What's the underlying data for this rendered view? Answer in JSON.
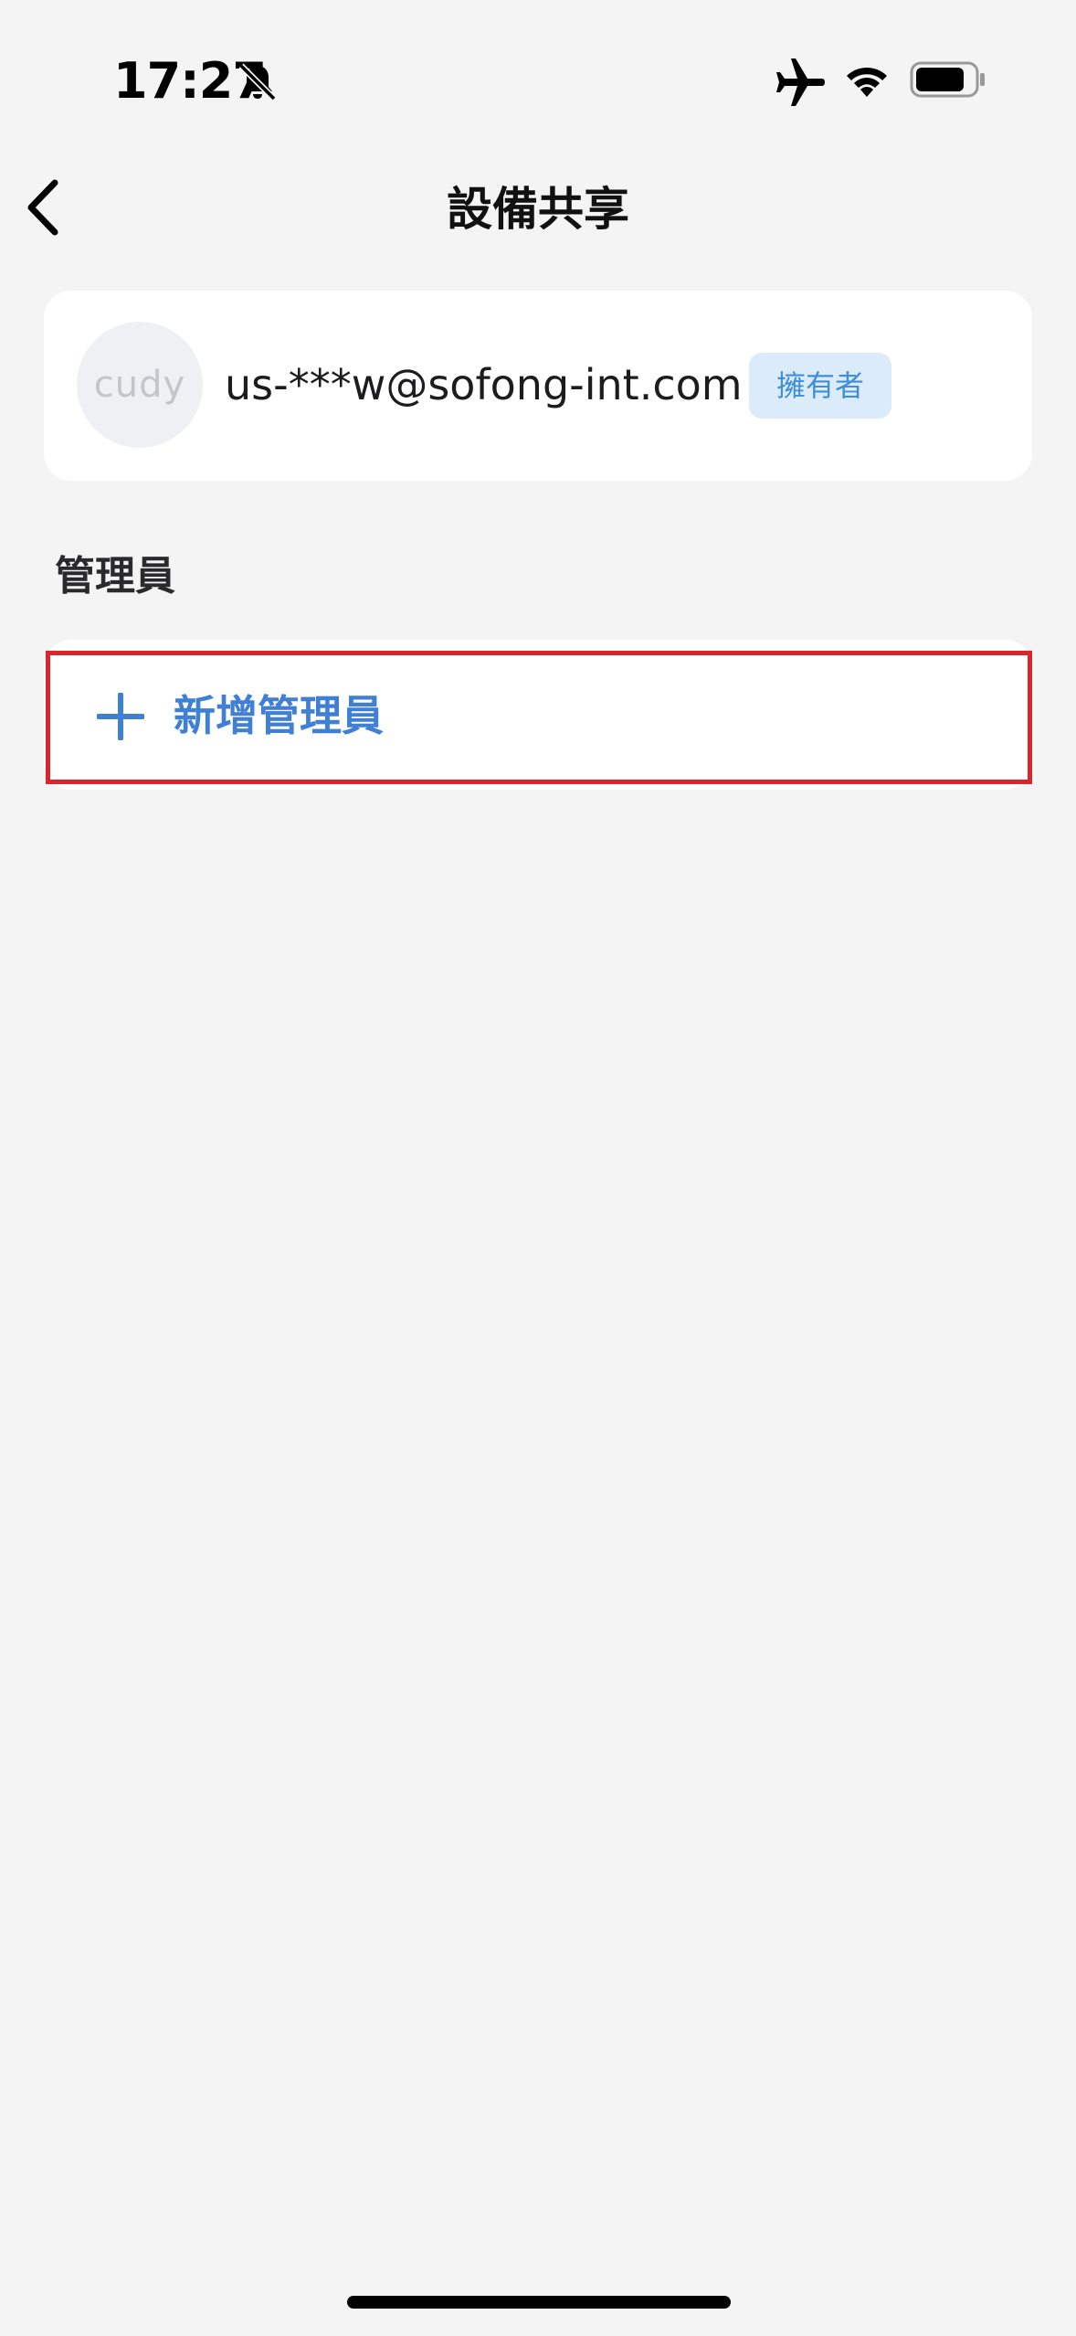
{
  "status_bar": {
    "time": "17:27",
    "icons": [
      "bell-slash-icon",
      "airplane-icon",
      "wifi-icon",
      "battery-icon"
    ]
  },
  "nav": {
    "title": "設備共享",
    "back_icon": "chevron-left-icon"
  },
  "owner": {
    "avatar_text": "cudy",
    "email": "us-***w@sofong-int.com",
    "badge": "擁有者"
  },
  "admins_section": {
    "title": "管理員",
    "add_label": "新增管理員",
    "add_icon": "plus-icon"
  },
  "colors": {
    "background": "#f4f4f4",
    "card": "#ffffff",
    "accent": "#3f7fd4",
    "badge_bg": "#dcebfa",
    "badge_text": "#3f8fd8",
    "highlight": "#d9262a"
  }
}
